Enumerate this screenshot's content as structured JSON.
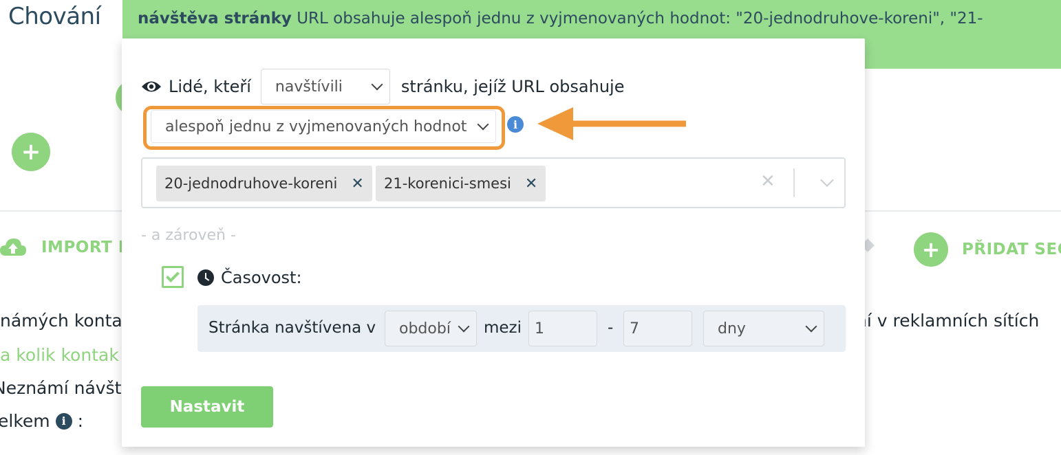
{
  "background": {
    "page_title": "Chování",
    "import_label": "IMPORT K",
    "add_segment_label": "PŘIDAT SEG",
    "text_line1": "námých konta",
    "text_line2": "a kolik kontak",
    "text_line3": "Neznámí návšt",
    "text_line4": "elkem",
    "text_right": "ní v reklamních sítích",
    "colon": ":"
  },
  "banner": {
    "bold": "návštěva stránky",
    "rest": " URL obsahuje alespoň jednu z vyjmenovaných hodnot: \"20-jednodruhove-koreni\", \"21-"
  },
  "modal": {
    "people_label": "Lidé, kteří",
    "visited_select": "navštívili",
    "url_label": "stránku, jejíž URL obsahuje",
    "match_select": "alespoň jednu z vyjmenovaných hodnot",
    "tags": [
      "20-jednodruhove-koreni",
      "21-korenici-smesi"
    ],
    "and_label": "- a zároveň -",
    "timing_label": "Časovost:",
    "timing": {
      "prefix": "Stránka navštívena v",
      "period_select": "období",
      "between": "mezi",
      "from": "1",
      "dash": "-",
      "to": "7",
      "unit_select": "dny"
    },
    "submit": "Nastavit"
  },
  "colors": {
    "accent_green": "#8fd47f",
    "banner_green": "#98dc8e",
    "highlight_orange": "#f0993a",
    "info_blue": "#4a8ad6"
  }
}
